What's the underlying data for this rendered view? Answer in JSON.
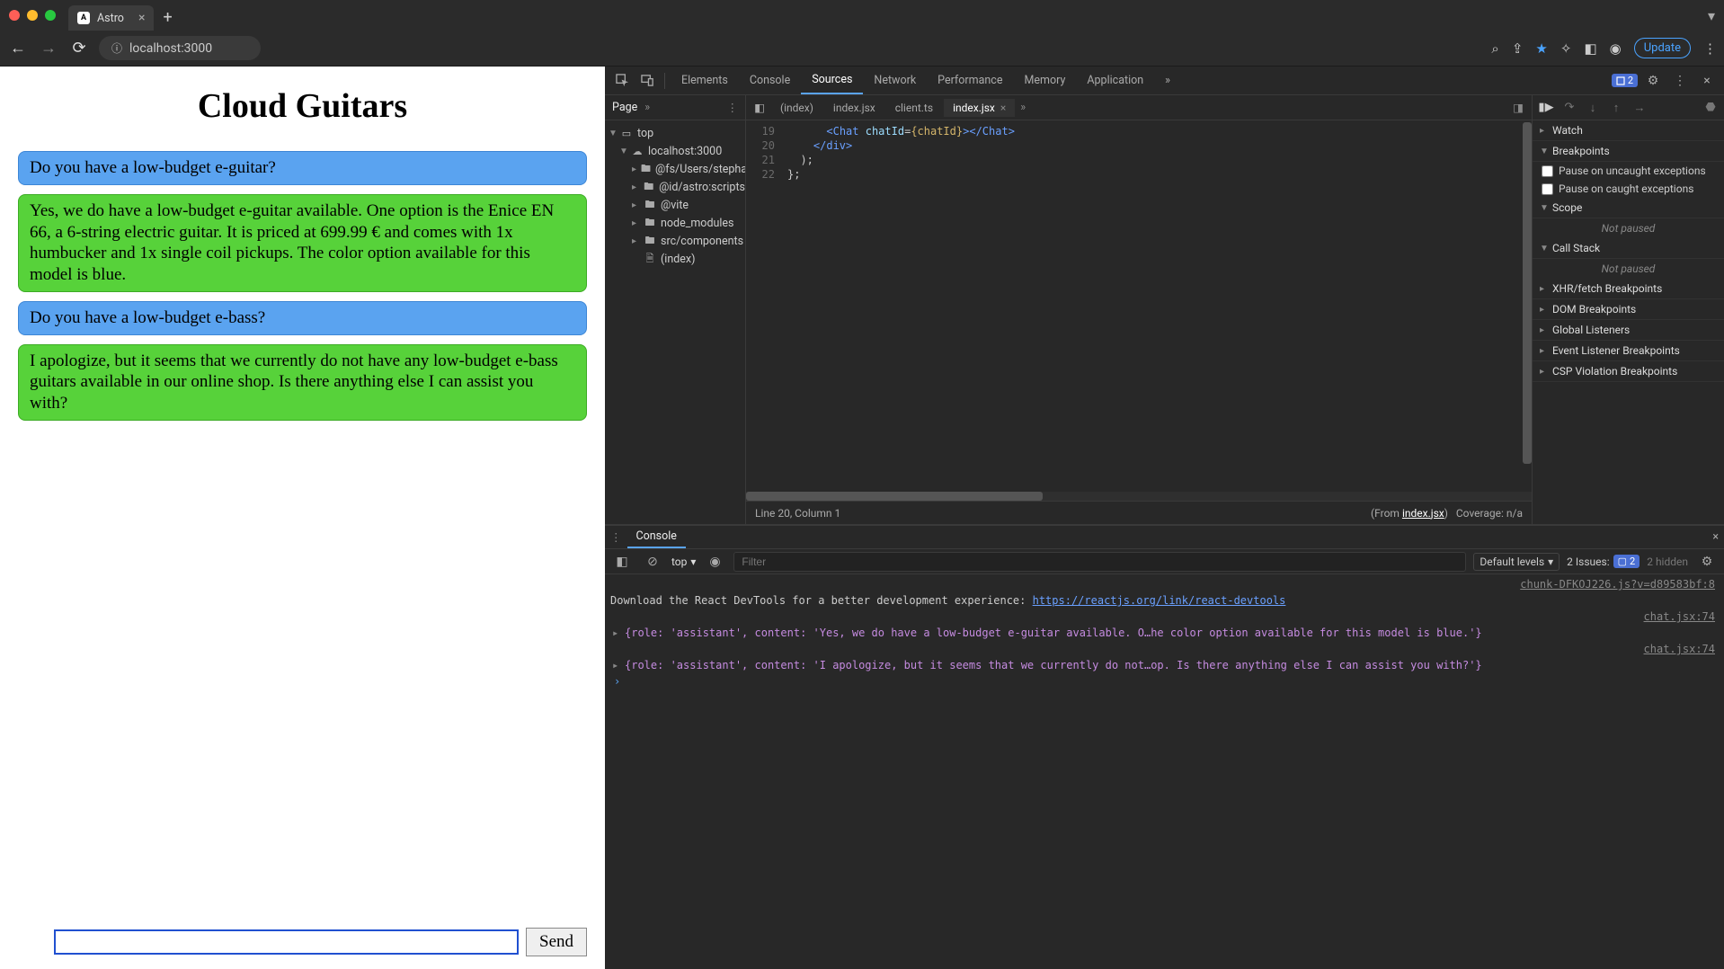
{
  "browser": {
    "tab_title": "Astro",
    "url": "localhost:3000",
    "update_label": "Update"
  },
  "page": {
    "title": "Cloud Guitars",
    "messages": [
      {
        "role": "user",
        "text": "Do you have a low-budget e-guitar?"
      },
      {
        "role": "assistant",
        "text": "Yes, we do have a low-budget e-guitar available. One option is the Enice EN 66, a 6-string electric guitar. It is priced at 699.99 € and comes with 1x humbucker and 1x single coil pickups. The color option available for this model is blue."
      },
      {
        "role": "user",
        "text": "Do you have a low-budget e-bass?"
      },
      {
        "role": "assistant",
        "text": "I apologize, but it seems that we currently do not have any low-budget e-bass guitars available in our online shop. Is there anything else I can assist you with?"
      }
    ],
    "send_label": "Send"
  },
  "devtools": {
    "panels": {
      "elements": "Elements",
      "console": "Console",
      "sources": "Sources",
      "network": "Network",
      "performance": "Performance",
      "memory": "Memory",
      "application": "Application"
    },
    "issue_count": "2",
    "navigator": {
      "page_tab": "Page",
      "tree": {
        "top": "top",
        "host": "localhost:3000",
        "items": [
          "@fs/Users/stepha",
          "@id/astro:scripts",
          "@vite",
          "node_modules",
          "src/components"
        ],
        "file": "(index)"
      }
    },
    "editor": {
      "tabs": {
        "t1": "(index)",
        "t2": "index.jsx",
        "t3": "client.ts",
        "t4": "index.jsx"
      },
      "gutter": [
        "19",
        "20",
        "21",
        "22"
      ],
      "code_l1_a": "<",
      "code_l1_b": "Chat",
      "code_l1_c": " chatId",
      "code_l1_d": "=",
      "code_l1_e": "{chatId}",
      "code_l1_f": ">",
      "code_l1_g": "</",
      "code_l1_h": "Chat",
      "code_l1_i": ">",
      "code_l2_a": "</",
      "code_l2_b": "div",
      "code_l2_c": ">",
      "code_l3": ");",
      "code_l4": "};",
      "status_left": "Line 20, Column 1",
      "status_from": "(From ",
      "status_src": "index.jsx",
      "status_close": ")",
      "coverage": "Coverage: n/a"
    },
    "debugger": {
      "watch": "Watch",
      "breakpoints": "Breakpoints",
      "pause_uncaught": "Pause on uncaught exceptions",
      "pause_caught": "Pause on caught exceptions",
      "scope": "Scope",
      "not_paused": "Not paused",
      "call_stack": "Call Stack",
      "xhr": "XHR/fetch Breakpoints",
      "dom": "DOM Breakpoints",
      "global": "Global Listeners",
      "event": "Event Listener Breakpoints",
      "csp": "CSP Violation Breakpoints"
    },
    "console": {
      "tab": "Console",
      "context": "top",
      "filter_placeholder": "Filter",
      "levels": "Default levels",
      "issues_label": "2 Issues:",
      "issues_badge": "2",
      "hidden": "2 hidden",
      "src_chunk": "chunk-DFKOJ226.js?v=d89583bf:8",
      "msg_info_a": "Download the React DevTools for a better development experience: ",
      "msg_info_url": "https://reactjs.org/link/react-devtools",
      "src_chat": "chat.jsx:74",
      "obj1": "{role: 'assistant', content: 'Yes, we do have a low-budget e-guitar available. O…he color option available for this model is blue.'}",
      "obj2": "{role: 'assistant', content: 'I apologize, but it seems that we currently do not…op. Is there anything else I can assist you with?'}"
    }
  }
}
